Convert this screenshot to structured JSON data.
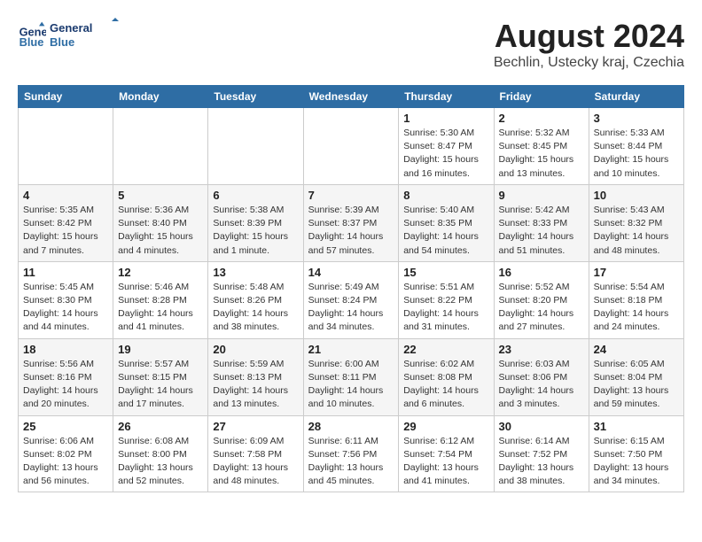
{
  "header": {
    "logo_line1": "General",
    "logo_line2": "Blue",
    "title": "August 2024",
    "subtitle": "Bechlin, Ustecky kraj, Czechia"
  },
  "days_of_week": [
    "Sunday",
    "Monday",
    "Tuesday",
    "Wednesday",
    "Thursday",
    "Friday",
    "Saturday"
  ],
  "weeks": [
    [
      {
        "day": "",
        "info": ""
      },
      {
        "day": "",
        "info": ""
      },
      {
        "day": "",
        "info": ""
      },
      {
        "day": "",
        "info": ""
      },
      {
        "day": "1",
        "info": "Sunrise: 5:30 AM\nSunset: 8:47 PM\nDaylight: 15 hours\nand 16 minutes."
      },
      {
        "day": "2",
        "info": "Sunrise: 5:32 AM\nSunset: 8:45 PM\nDaylight: 15 hours\nand 13 minutes."
      },
      {
        "day": "3",
        "info": "Sunrise: 5:33 AM\nSunset: 8:44 PM\nDaylight: 15 hours\nand 10 minutes."
      }
    ],
    [
      {
        "day": "4",
        "info": "Sunrise: 5:35 AM\nSunset: 8:42 PM\nDaylight: 15 hours\nand 7 minutes."
      },
      {
        "day": "5",
        "info": "Sunrise: 5:36 AM\nSunset: 8:40 PM\nDaylight: 15 hours\nand 4 minutes."
      },
      {
        "day": "6",
        "info": "Sunrise: 5:38 AM\nSunset: 8:39 PM\nDaylight: 15 hours\nand 1 minute."
      },
      {
        "day": "7",
        "info": "Sunrise: 5:39 AM\nSunset: 8:37 PM\nDaylight: 14 hours\nand 57 minutes."
      },
      {
        "day": "8",
        "info": "Sunrise: 5:40 AM\nSunset: 8:35 PM\nDaylight: 14 hours\nand 54 minutes."
      },
      {
        "day": "9",
        "info": "Sunrise: 5:42 AM\nSunset: 8:33 PM\nDaylight: 14 hours\nand 51 minutes."
      },
      {
        "day": "10",
        "info": "Sunrise: 5:43 AM\nSunset: 8:32 PM\nDaylight: 14 hours\nand 48 minutes."
      }
    ],
    [
      {
        "day": "11",
        "info": "Sunrise: 5:45 AM\nSunset: 8:30 PM\nDaylight: 14 hours\nand 44 minutes."
      },
      {
        "day": "12",
        "info": "Sunrise: 5:46 AM\nSunset: 8:28 PM\nDaylight: 14 hours\nand 41 minutes."
      },
      {
        "day": "13",
        "info": "Sunrise: 5:48 AM\nSunset: 8:26 PM\nDaylight: 14 hours\nand 38 minutes."
      },
      {
        "day": "14",
        "info": "Sunrise: 5:49 AM\nSunset: 8:24 PM\nDaylight: 14 hours\nand 34 minutes."
      },
      {
        "day": "15",
        "info": "Sunrise: 5:51 AM\nSunset: 8:22 PM\nDaylight: 14 hours\nand 31 minutes."
      },
      {
        "day": "16",
        "info": "Sunrise: 5:52 AM\nSunset: 8:20 PM\nDaylight: 14 hours\nand 27 minutes."
      },
      {
        "day": "17",
        "info": "Sunrise: 5:54 AM\nSunset: 8:18 PM\nDaylight: 14 hours\nand 24 minutes."
      }
    ],
    [
      {
        "day": "18",
        "info": "Sunrise: 5:56 AM\nSunset: 8:16 PM\nDaylight: 14 hours\nand 20 minutes."
      },
      {
        "day": "19",
        "info": "Sunrise: 5:57 AM\nSunset: 8:15 PM\nDaylight: 14 hours\nand 17 minutes."
      },
      {
        "day": "20",
        "info": "Sunrise: 5:59 AM\nSunset: 8:13 PM\nDaylight: 14 hours\nand 13 minutes."
      },
      {
        "day": "21",
        "info": "Sunrise: 6:00 AM\nSunset: 8:11 PM\nDaylight: 14 hours\nand 10 minutes."
      },
      {
        "day": "22",
        "info": "Sunrise: 6:02 AM\nSunset: 8:08 PM\nDaylight: 14 hours\nand 6 minutes."
      },
      {
        "day": "23",
        "info": "Sunrise: 6:03 AM\nSunset: 8:06 PM\nDaylight: 14 hours\nand 3 minutes."
      },
      {
        "day": "24",
        "info": "Sunrise: 6:05 AM\nSunset: 8:04 PM\nDaylight: 13 hours\nand 59 minutes."
      }
    ],
    [
      {
        "day": "25",
        "info": "Sunrise: 6:06 AM\nSunset: 8:02 PM\nDaylight: 13 hours\nand 56 minutes."
      },
      {
        "day": "26",
        "info": "Sunrise: 6:08 AM\nSunset: 8:00 PM\nDaylight: 13 hours\nand 52 minutes."
      },
      {
        "day": "27",
        "info": "Sunrise: 6:09 AM\nSunset: 7:58 PM\nDaylight: 13 hours\nand 48 minutes."
      },
      {
        "day": "28",
        "info": "Sunrise: 6:11 AM\nSunset: 7:56 PM\nDaylight: 13 hours\nand 45 minutes."
      },
      {
        "day": "29",
        "info": "Sunrise: 6:12 AM\nSunset: 7:54 PM\nDaylight: 13 hours\nand 41 minutes."
      },
      {
        "day": "30",
        "info": "Sunrise: 6:14 AM\nSunset: 7:52 PM\nDaylight: 13 hours\nand 38 minutes."
      },
      {
        "day": "31",
        "info": "Sunrise: 6:15 AM\nSunset: 7:50 PM\nDaylight: 13 hours\nand 34 minutes."
      }
    ]
  ]
}
